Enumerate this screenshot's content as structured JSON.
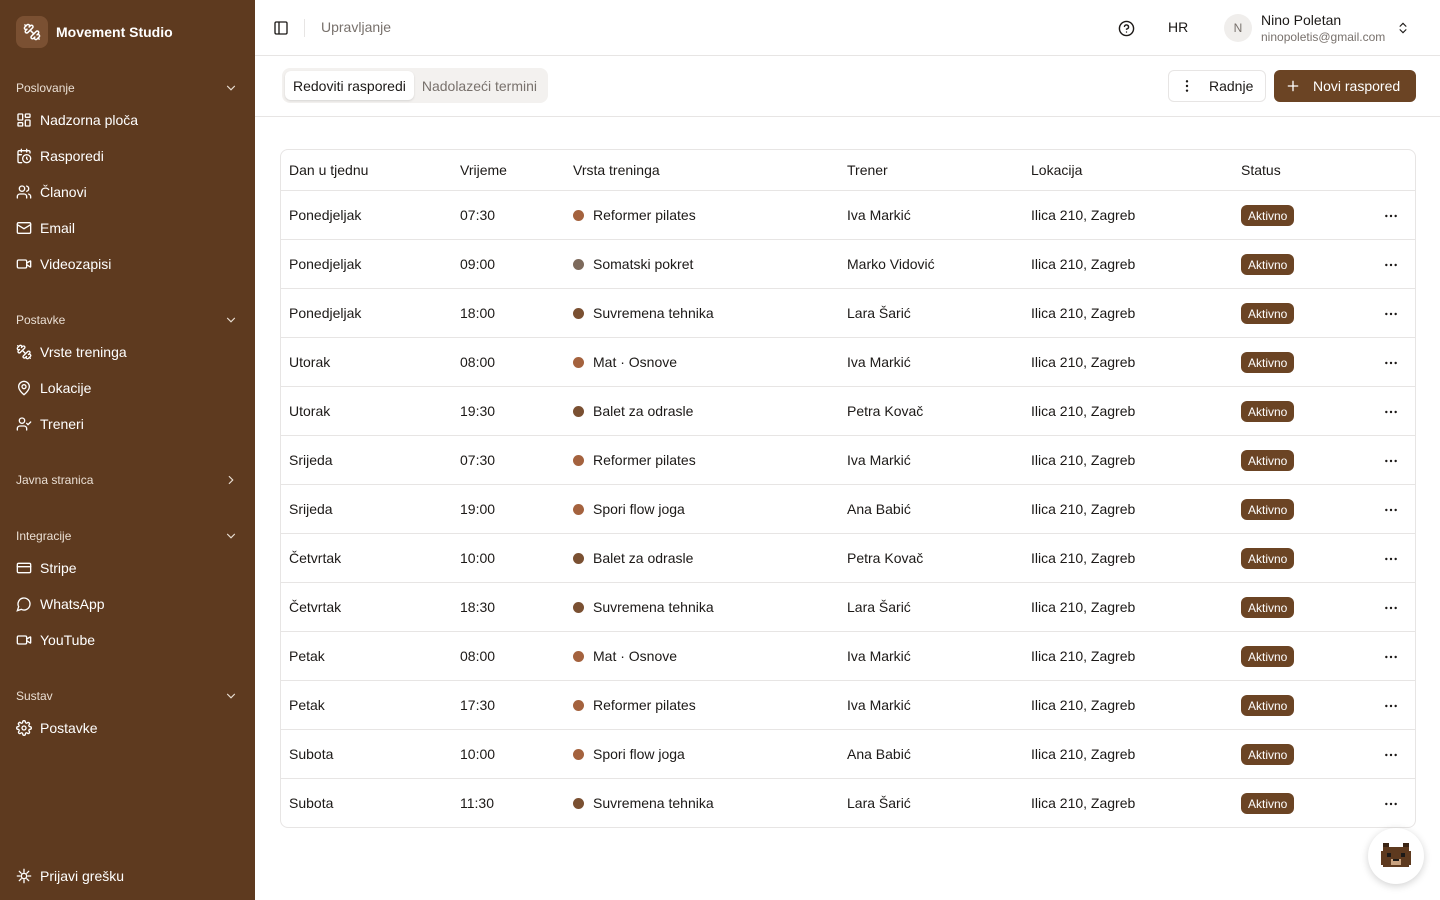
{
  "app": {
    "name": "Movement Studio"
  },
  "colors": {
    "sidebar": "#5e3a1f",
    "accent": "#6b4424",
    "dot_light": "#a4623e",
    "dot_dark": "#7a5032",
    "dot_gray": "#7d6a5c"
  },
  "sidebar": {
    "groups": [
      {
        "label": "Poslovanje",
        "chevron": "chevron-down-icon",
        "items": [
          {
            "label": "Nadzorna ploča",
            "icon": "dashboard-icon"
          },
          {
            "label": "Rasporedi",
            "icon": "calendar-clock-icon"
          },
          {
            "label": "Članovi",
            "icon": "users-icon"
          },
          {
            "label": "Email",
            "icon": "mail-icon"
          },
          {
            "label": "Videozapisi",
            "icon": "video-icon"
          }
        ]
      },
      {
        "label": "Postavke",
        "chevron": "chevron-down-icon",
        "items": [
          {
            "label": "Vrste treninga",
            "icon": "dumbbell-icon"
          },
          {
            "label": "Lokacije",
            "icon": "map-pin-icon"
          },
          {
            "label": "Treneri",
            "icon": "user-check-icon"
          }
        ]
      },
      {
        "label": "Javna stranica",
        "chevron": "chevron-right-icon",
        "items": []
      },
      {
        "label": "Integracije",
        "chevron": "chevron-down-icon",
        "items": [
          {
            "label": "Stripe",
            "icon": "credit-card-icon"
          },
          {
            "label": "WhatsApp",
            "icon": "message-circle-icon"
          },
          {
            "label": "YouTube",
            "icon": "video-icon"
          }
        ]
      },
      {
        "label": "Sustav",
        "chevron": "chevron-down-icon",
        "items": [
          {
            "label": "Postavke",
            "icon": "gear-icon"
          }
        ]
      }
    ],
    "footer": {
      "label": "Prijavi grešku",
      "icon": "bug-icon"
    }
  },
  "header": {
    "breadcrumb": "Upravljanje",
    "language": "HR",
    "user": {
      "initial": "N",
      "name": "Nino Poletan",
      "email": "ninopoletis@gmail.com"
    }
  },
  "toolbar": {
    "tabs": [
      {
        "label": "Redoviti rasporedi",
        "active": true
      },
      {
        "label": "Nadolazeći termini",
        "active": false
      }
    ],
    "actions_label": "Radnje",
    "new_label": "Novi raspored"
  },
  "table": {
    "columns": [
      "Dan u tjednu",
      "Vrijeme",
      "Vrsta treninga",
      "Trener",
      "Lokacija",
      "Status"
    ],
    "rows": [
      {
        "day": "Ponedjeljak",
        "time": "07:30",
        "type": "Reformer pilates",
        "dot": "#a4623e",
        "trainer": "Iva Markić",
        "location": "Ilica 210, Zagreb",
        "status": "Aktivno"
      },
      {
        "day": "Ponedjeljak",
        "time": "09:00",
        "type": "Somatski pokret",
        "dot": "#7d6a5c",
        "trainer": "Marko Vidović",
        "location": "Ilica 210, Zagreb",
        "status": "Aktivno"
      },
      {
        "day": "Ponedjeljak",
        "time": "18:00",
        "type": "Suvremena tehnika",
        "dot": "#7a5032",
        "trainer": "Lara Šarić",
        "location": "Ilica 210, Zagreb",
        "status": "Aktivno"
      },
      {
        "day": "Utorak",
        "time": "08:00",
        "type": "Mat · Osnove",
        "dot": "#a4623e",
        "trainer": "Iva Markić",
        "location": "Ilica 210, Zagreb",
        "status": "Aktivno"
      },
      {
        "day": "Utorak",
        "time": "19:30",
        "type": "Balet za odrasle",
        "dot": "#7a5032",
        "trainer": "Petra Kovač",
        "location": "Ilica 210, Zagreb",
        "status": "Aktivno"
      },
      {
        "day": "Srijeda",
        "time": "07:30",
        "type": "Reformer pilates",
        "dot": "#a4623e",
        "trainer": "Iva Markić",
        "location": "Ilica 210, Zagreb",
        "status": "Aktivno"
      },
      {
        "day": "Srijeda",
        "time": "19:00",
        "type": "Spori flow joga",
        "dot": "#a4623e",
        "trainer": "Ana Babić",
        "location": "Ilica 210, Zagreb",
        "status": "Aktivno"
      },
      {
        "day": "Četvrtak",
        "time": "10:00",
        "type": "Balet za odrasle",
        "dot": "#7a5032",
        "trainer": "Petra Kovač",
        "location": "Ilica 210, Zagreb",
        "status": "Aktivno"
      },
      {
        "day": "Četvrtak",
        "time": "18:30",
        "type": "Suvremena tehnika",
        "dot": "#7a5032",
        "trainer": "Lara Šarić",
        "location": "Ilica 210, Zagreb",
        "status": "Aktivno"
      },
      {
        "day": "Petak",
        "time": "08:00",
        "type": "Mat · Osnove",
        "dot": "#a4623e",
        "trainer": "Iva Markić",
        "location": "Ilica 210, Zagreb",
        "status": "Aktivno"
      },
      {
        "day": "Petak",
        "time": "17:30",
        "type": "Reformer pilates",
        "dot": "#a4623e",
        "trainer": "Iva Markić",
        "location": "Ilica 210, Zagreb",
        "status": "Aktivno"
      },
      {
        "day": "Subota",
        "time": "10:00",
        "type": "Spori flow joga",
        "dot": "#a4623e",
        "trainer": "Ana Babić",
        "location": "Ilica 210, Zagreb",
        "status": "Aktivno"
      },
      {
        "day": "Subota",
        "time": "11:30",
        "type": "Suvremena tehnika",
        "dot": "#7a5032",
        "trainer": "Lara Šarić",
        "location": "Ilica 210, Zagreb",
        "status": "Aktivno"
      }
    ]
  }
}
